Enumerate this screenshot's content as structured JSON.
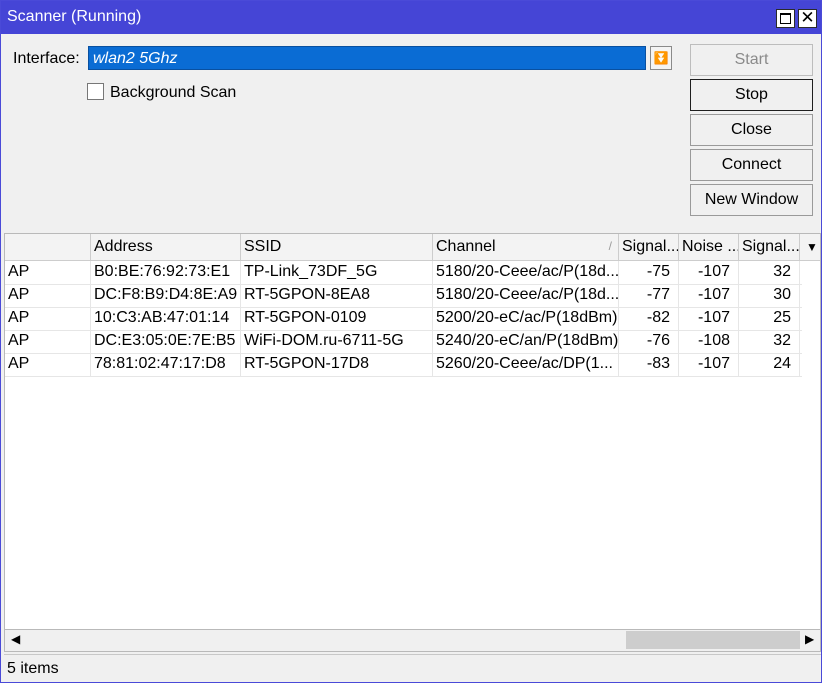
{
  "window": {
    "title": "Scanner (Running)",
    "maximize_icon": "maximize-icon",
    "close_icon": "close-icon"
  },
  "form": {
    "interface_label": "Interface:",
    "interface_value": "wlan2 5Ghz",
    "background_scan_label": "Background Scan",
    "background_scan_checked": false
  },
  "buttons": {
    "start": "Start",
    "stop": "Stop",
    "close": "Close",
    "connect": "Connect",
    "new_window": "New Window"
  },
  "table": {
    "headers": {
      "type": "",
      "address": "Address",
      "ssid": "SSID",
      "channel": "Channel",
      "signal": "Signal...",
      "noise": "Noise ...",
      "snr": "Signal..."
    },
    "rows": [
      {
        "type": "AP",
        "address": "B0:BE:76:92:73:E1",
        "ssid": "TP-Link_73DF_5G",
        "channel": "5180/20-Ceee/ac/P(18d...",
        "signal": "-75",
        "noise": "-107",
        "snr": "32"
      },
      {
        "type": "AP",
        "address": "DC:F8:B9:D4:8E:A9",
        "ssid": "RT-5GPON-8EA8",
        "channel": "5180/20-Ceee/ac/P(18d...",
        "signal": "-77",
        "noise": "-107",
        "snr": "30"
      },
      {
        "type": "AP",
        "address": "10:C3:AB:47:01:14",
        "ssid": "RT-5GPON-0109",
        "channel": "5200/20-eC/ac/P(18dBm)",
        "signal": "-82",
        "noise": "-107",
        "snr": "25"
      },
      {
        "type": "AP",
        "address": "DC:E3:05:0E:7E:B5",
        "ssid": "WiFi-DOM.ru-6711-5G",
        "channel": "5240/20-eC/an/P(18dBm)",
        "signal": "-76",
        "noise": "-108",
        "snr": "32"
      },
      {
        "type": "AP",
        "address": "78:81:02:47:17:D8",
        "ssid": "RT-5GPON-17D8",
        "channel": "5260/20-Ceee/ac/DP(1...",
        "signal": "-83",
        "noise": "-107",
        "snr": "24"
      }
    ]
  },
  "status": {
    "text": "5 items"
  },
  "colors": {
    "title_bar": "#4545d6",
    "selection": "#0a6cd4"
  }
}
